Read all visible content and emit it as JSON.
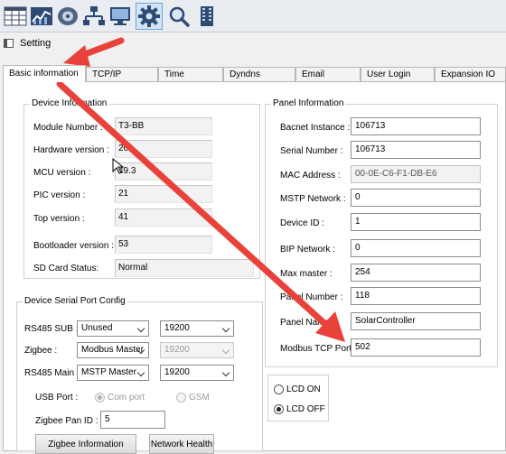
{
  "toolbar": {
    "buttons": [
      {
        "id": "grid-icon"
      },
      {
        "id": "chart-icon"
      },
      {
        "id": "disc-icon"
      },
      {
        "id": "network-icon"
      },
      {
        "id": "monitor-icon"
      },
      {
        "id": "gear-icon",
        "active": true
      },
      {
        "id": "magnifier-icon"
      },
      {
        "id": "building-icon"
      }
    ]
  },
  "window": {
    "title": "Setting"
  },
  "tabs": [
    {
      "label": "Basic information",
      "active": true
    },
    {
      "label": "TCP/IP"
    },
    {
      "label": "Time"
    },
    {
      "label": "Dyndns"
    },
    {
      "label": "Email"
    },
    {
      "label": "User Login"
    },
    {
      "label": "Expansion IO"
    }
  ],
  "device_info": {
    "legend": "Device Information",
    "rows": [
      {
        "label": "Module Number :",
        "value": "T3-BB"
      },
      {
        "label": "Hardware version :",
        "value": "26"
      },
      {
        "label": "MCU version :",
        "value": "49.3"
      },
      {
        "label": "PIC version :",
        "value": "21"
      },
      {
        "label": "Top version :",
        "value": "41"
      },
      {
        "label": "Bootloader version :",
        "value": "53"
      },
      {
        "label": "SD Card Status:",
        "value": "Normal"
      }
    ]
  },
  "panel_info": {
    "legend": "Panel Information",
    "rows": [
      {
        "label": "Bacnet Instance :",
        "value": "106713"
      },
      {
        "label": "Serial Number :",
        "value": "106713"
      },
      {
        "label": "MAC Address :",
        "value": "00-0E-C6-F1-DB-E6"
      },
      {
        "label": "MSTP Network :",
        "value": "0"
      },
      {
        "label": "Device ID :",
        "value": "1"
      },
      {
        "label": "BIP Network :",
        "value": "0"
      },
      {
        "label": "Max master :",
        "value": "254"
      },
      {
        "label": "Panel Number :",
        "value": "118"
      },
      {
        "label": "Panel Name",
        "value": "SolarController"
      },
      {
        "label": "Modbus TCP Port :",
        "value": "502"
      }
    ]
  },
  "serial_config": {
    "legend": "Device Serial Port Config",
    "rs485_sub": {
      "label": "RS485 SUB :",
      "mode": "Unused",
      "baud": "19200"
    },
    "zigbee": {
      "label": "Zigbee :",
      "mode": "Modbus Master",
      "baud": "19200"
    },
    "rs485_main": {
      "label": "RS485 Main :",
      "mode": "MSTP Master",
      "baud": "19200"
    },
    "usb_port": {
      "label": "USB Port :",
      "com_port": "Com port",
      "gsm": "GSM"
    },
    "zigbee_pan": {
      "label": "Zigbee Pan ID :",
      "value": "5"
    },
    "zigbee_info_button": "Zigbee Information",
    "network_health_button": "Network Health"
  },
  "lcd": {
    "on_label": "LCD ON",
    "off_label": "LCD OFF",
    "selected": "off"
  },
  "colors": {
    "arrow": "#e8423a",
    "toolbar_active": "#cfe4f7"
  }
}
